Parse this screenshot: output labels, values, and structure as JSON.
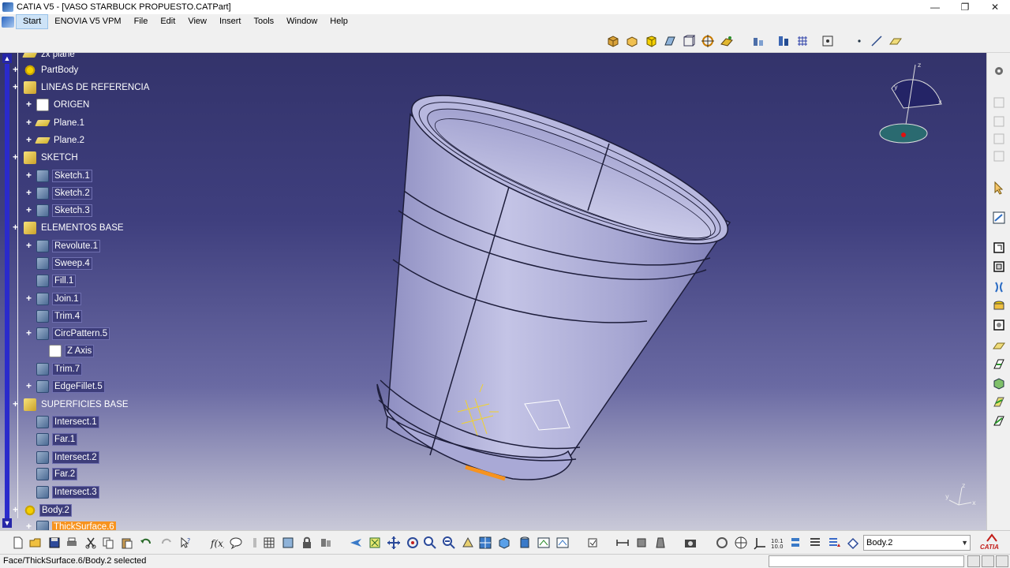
{
  "window": {
    "title": "CATIA V5 - [VASO STARBUCK PROPUESTO.CATPart]",
    "minimize": "—",
    "restore": "❐",
    "close": "✕"
  },
  "menu": {
    "items": [
      "Start",
      "ENOVIA V5 VPM",
      "File",
      "Edit",
      "View",
      "Insert",
      "Tools",
      "Window",
      "Help"
    ]
  },
  "tree": {
    "items": [
      {
        "label": "zx plane",
        "icon": "plane-icon",
        "level": 1
      },
      {
        "label": "PartBody",
        "icon": "gear-icon",
        "level": 1
      },
      {
        "label": "LINEAS DE REFERENCIA",
        "icon": "geometrical-set-icon",
        "level": 1
      },
      {
        "label": "ORIGEN",
        "icon": "point-icon",
        "level": 2
      },
      {
        "label": "Plane.1",
        "icon": "plane-icon",
        "level": 2
      },
      {
        "label": "Plane.2",
        "icon": "plane-icon",
        "level": 2
      },
      {
        "label": "SKETCH",
        "icon": "geometrical-set-icon",
        "level": 1
      },
      {
        "label": "Sketch.1",
        "icon": "sketch-icon",
        "level": 2
      },
      {
        "label": "Sketch.2",
        "icon": "sketch-icon",
        "level": 2
      },
      {
        "label": "Sketch.3",
        "icon": "sketch-icon",
        "level": 2
      },
      {
        "label": "ELEMENTOS BASE",
        "icon": "geometrical-set-icon",
        "level": 1
      },
      {
        "label": "Revolute.1",
        "icon": "revolute-icon",
        "level": 2
      },
      {
        "label": "Sweep.4",
        "icon": "sweep-icon",
        "level": 2
      },
      {
        "label": "Fill.1",
        "icon": "fill-icon",
        "level": 2
      },
      {
        "label": "Join.1",
        "icon": "join-icon",
        "level": 2
      },
      {
        "label": "Trim.4",
        "icon": "trim-icon",
        "level": 2
      },
      {
        "label": "CircPattern.5",
        "icon": "circ-pattern-icon",
        "level": 2
      },
      {
        "label": "Z Axis",
        "icon": "axis-icon",
        "level": 3
      },
      {
        "label": "Trim.7",
        "icon": "trim-icon",
        "level": 2
      },
      {
        "label": "EdgeFillet.5",
        "icon": "edge-fillet-icon",
        "level": 2
      },
      {
        "label": "SUPERFICIES BASE",
        "icon": "geometrical-set-icon",
        "level": 1
      },
      {
        "label": "Intersect.1",
        "icon": "intersect-icon",
        "level": 2
      },
      {
        "label": "Far.1",
        "icon": "far-icon",
        "level": 2
      },
      {
        "label": "Intersect.2",
        "icon": "intersect-icon",
        "level": 2
      },
      {
        "label": "Far.2",
        "icon": "far-icon",
        "level": 2
      },
      {
        "label": "Intersect.3",
        "icon": "intersect-icon",
        "level": 2
      },
      {
        "label": "Body.2",
        "icon": "gear-icon",
        "level": 1
      },
      {
        "label": "ThickSurface.6",
        "icon": "thick-surface-icon",
        "level": 2
      }
    ]
  },
  "compass": {
    "x": "x",
    "y": "y",
    "z": "z"
  },
  "axis_triad": {
    "x": "x",
    "y": "y",
    "z": "z"
  },
  "bottom": {
    "current_body": "Body.2",
    "logo": "CATIA"
  },
  "status": {
    "text": "Face/ThickSurface.6/Body.2 selected"
  },
  "colors": {
    "background_top": "#33336b",
    "background_bottom": "#c9c9d8",
    "part_surface": "#b9b9e0",
    "selection": "#f7931e"
  }
}
